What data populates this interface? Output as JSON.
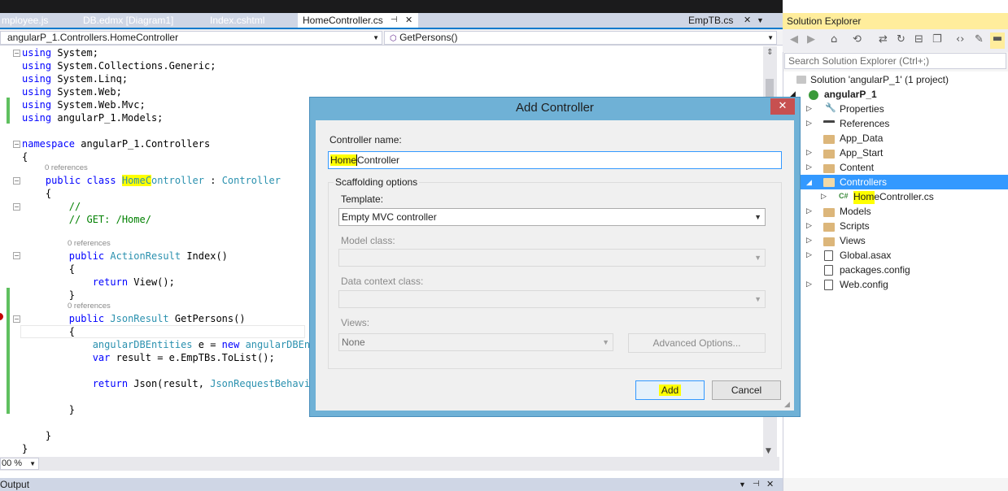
{
  "tabs": [
    {
      "label": "mployee.js"
    },
    {
      "label": "DB.edmx [Diagram1]"
    },
    {
      "label": "Index.cshtml"
    },
    {
      "label": "HomeController.cs"
    },
    {
      "label": "EmpTB.cs"
    }
  ],
  "navbar": {
    "type_selector": "angularP_1.Controllers.HomeController",
    "member_selector": "GetPersons()"
  },
  "code": {
    "lines": [
      "using System;",
      "using System.Collections.Generic;",
      "using System.Linq;",
      "using System.Web;",
      "using System.Web.Mvc;",
      "using angularP_1.Models;",
      "namespace angularP_1.Controllers",
      "{",
      "public class HomeController : Controller",
      "{",
      "//",
      "// GET: /Home/",
      "public ActionResult Index()",
      "{",
      "return View();",
      "}",
      "public JsonResult GetPersons()",
      "{",
      "angularDBEntities e = new angularDBEnti",
      "var result = e.EmpTBs.ToList();",
      "return Json(result, JsonRequestBehavio",
      "}",
      "}",
      "}"
    ],
    "references": "0 references"
  },
  "zoom": "00 %",
  "output_label": "Output",
  "solution_explorer": {
    "title": "Solution Explorer",
    "search_placeholder": "Search Solution Explorer (Ctrl+;)",
    "tree": [
      "Solution 'angularP_1' (1 project)",
      "angularP_1",
      "Properties",
      "References",
      "App_Data",
      "App_Start",
      "Content",
      "Controllers",
      "HomeController.cs",
      "Models",
      "Scripts",
      "Views",
      "Global.asax",
      "packages.config",
      "Web.config"
    ],
    "cs_badge": "C#"
  },
  "dialog": {
    "title": "Add Controller",
    "close": "✕",
    "controller_name_label": "Controller name:",
    "controller_name_value": "HomeController",
    "controller_name_highlight": "Home",
    "controller_name_rest": "Controller",
    "scaffolding_label": "Scaffolding options",
    "template_label": "Template:",
    "template_value": "Empty MVC controller",
    "model_class_label": "Model class:",
    "data_context_label": "Data context class:",
    "views_label": "Views:",
    "views_value": "None",
    "advanced_button": "Advanced Options...",
    "add_button": "Add",
    "cancel_button": "Cancel"
  },
  "colors": {
    "accent": "#007acc",
    "highlight": "#ffff00",
    "selection": "#3399ff",
    "dialog_frame": "#6fb1d6"
  }
}
